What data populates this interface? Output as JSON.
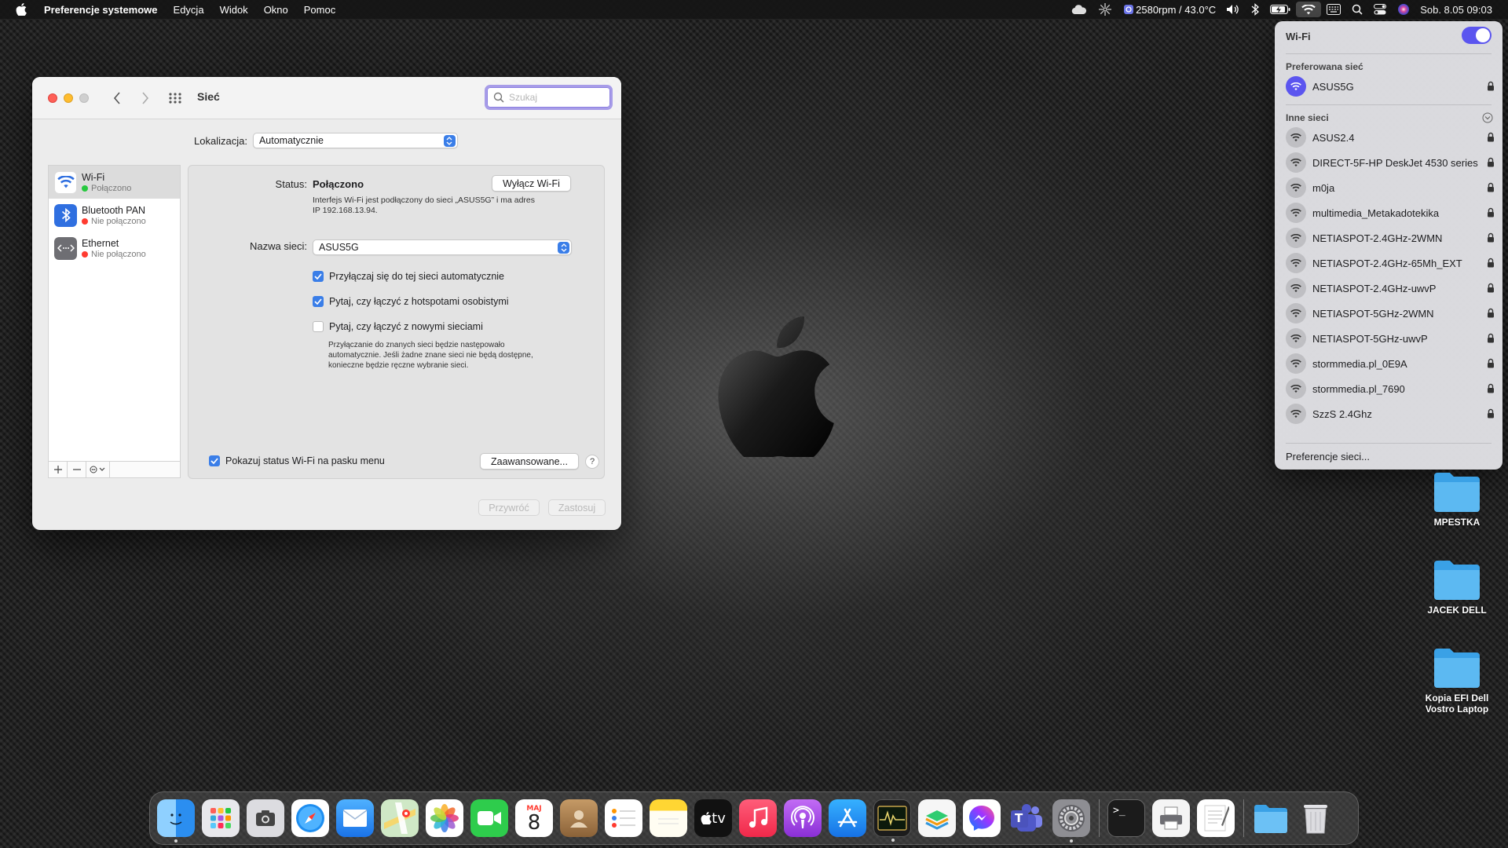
{
  "menubar": {
    "app_name": "Preferencje systemowe",
    "menus": [
      "Edycja",
      "Widok",
      "Okno",
      "Pomoc"
    ],
    "fan_temp": "2580rpm / 43.0°C",
    "datetime": "Sob. 8.05  09:03"
  },
  "window": {
    "title": "Sieć",
    "search_placeholder": "Szukaj",
    "location_label": "Lokalizacja:",
    "location_value": "Automatycznie",
    "services": [
      {
        "name": "Wi-Fi",
        "status": "Połączono",
        "status_color": "#27c93f"
      },
      {
        "name": "Bluetooth PAN",
        "status": "Nie połączono",
        "status_color": "#ff3b30"
      },
      {
        "name": "Ethernet",
        "status": "Nie połączono",
        "status_color": "#ff3b30"
      }
    ],
    "status_label": "Status:",
    "status_value": "Połączono",
    "turn_off_button": "Wyłącz Wi-Fi",
    "status_desc_1": "Interfejs Wi-Fi jest podłączony do sieci „ASUS5G” i ma adres",
    "status_desc_2": "IP 192.168.13.94.",
    "network_name_label": "Nazwa sieci:",
    "network_name_value": "ASUS5G",
    "checkbox_auto_join": "Przyłączaj się do tej sieci automatycznie",
    "checkbox_hotspots": "Pytaj, czy łączyć z hotspotami osobistymi",
    "checkbox_new_networks": "Pytaj, czy łączyć z nowymi sieciami",
    "note_1": "Przyłączanie do znanych sieci będzie następowało",
    "note_2": "automatycznie. Jeśli żadne znane sieci nie będą dostępne,",
    "note_3": "konieczne będzie ręczne wybranie sieci.",
    "show_status_label": "Pokazuj status Wi-Fi na pasku menu",
    "advanced_button": "Zaawansowane...",
    "help": "?",
    "revert_button": "Przywróć",
    "apply_button": "Zastosuj"
  },
  "wifi_menu": {
    "title": "Wi-Fi",
    "preferred_header": "Preferowana sieć",
    "preferred_network": "ASUS5G",
    "other_header": "Inne sieci",
    "networks": [
      "ASUS2.4",
      "DIRECT-5F-HP DeskJet 4530 series",
      "m0ja",
      "multimedia_Metakadotekika",
      "NETIASPOT-2.4GHz-2WMN",
      "NETIASPOT-2.4GHz-65Mh_EXT",
      "NETIASPOT-2.4GHz-uwvP",
      "NETIASPOT-5GHz-2WMN",
      "NETIASPOT-5GHz-uwvP",
      "stormmedia.pl_0E9A",
      "stormmedia.pl_7690",
      "SzzS 2.4Ghz"
    ],
    "footer": "Preferencje sieci..."
  },
  "desktop": {
    "folders": [
      "MPESTKA",
      "JACEK DELL",
      "Kopia EFI Dell Vostro Laptop"
    ]
  },
  "dock": {
    "calendar_month": "MAJ",
    "calendar_day": "8",
    "tv_label": "tv",
    "teams_letter": "T",
    "terminal_prompt": ">_"
  }
}
